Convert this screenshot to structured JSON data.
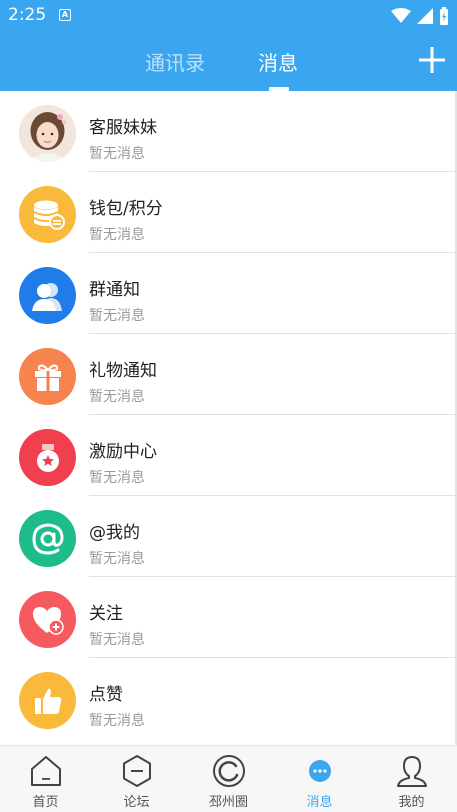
{
  "status_bar": {
    "time": "2:25",
    "badge": "A"
  },
  "header": {
    "tabs": [
      {
        "label": "通讯录",
        "active": false
      },
      {
        "label": "消息",
        "active": true
      }
    ],
    "add_icon": "plus-icon"
  },
  "messages": [
    {
      "title": "客服妹妹",
      "subtitle": "暂无消息",
      "icon": "user-photo-avatar",
      "color": "#e8d8c8"
    },
    {
      "title": "钱包/积分",
      "subtitle": "暂无消息",
      "icon": "coins-icon",
      "color": "#f9b93a"
    },
    {
      "title": "群通知",
      "subtitle": "暂无消息",
      "icon": "group-icon",
      "color": "#1f7ce8"
    },
    {
      "title": "礼物通知",
      "subtitle": "暂无消息",
      "icon": "gift-icon",
      "color": "#f7844e"
    },
    {
      "title": "激励中心",
      "subtitle": "暂无消息",
      "icon": "medal-icon",
      "color": "#f0404f"
    },
    {
      "title": "@我的",
      "subtitle": "暂无消息",
      "icon": "at-icon",
      "color": "#1ebc8a"
    },
    {
      "title": "关注",
      "subtitle": "暂无消息",
      "icon": "heart-plus-icon",
      "color": "#f55a5e"
    },
    {
      "title": "点赞",
      "subtitle": "暂无消息",
      "icon": "thumbs-up-icon",
      "color": "#f9b93a"
    }
  ],
  "tab_bar": {
    "items": [
      {
        "label": "首页",
        "icon": "home-icon",
        "active": false
      },
      {
        "label": "论坛",
        "icon": "forum-icon",
        "active": false
      },
      {
        "label": "邳州圈",
        "icon": "circle-icon",
        "active": false
      },
      {
        "label": "消息",
        "icon": "chat-bubble-icon",
        "active": true
      },
      {
        "label": "我的",
        "icon": "profile-icon",
        "active": false
      }
    ],
    "accent_color": "#3aa6f0"
  }
}
